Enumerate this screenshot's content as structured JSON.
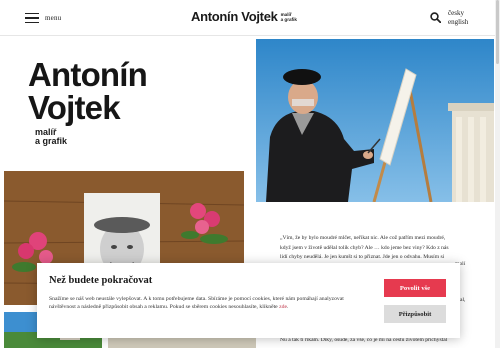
{
  "header": {
    "menu_label": "menu",
    "logo_name": "Antonín Vojtek",
    "logo_sub_1": "malíř",
    "logo_sub_2": "a grafik",
    "languages": [
      "česky",
      "english"
    ]
  },
  "hero": {
    "title_line1": "Antonín",
    "title_line2": "Vojtek",
    "sub_line1": "malíř",
    "sub_line2": "a grafik"
  },
  "article": {
    "lines": [
      "„Vím, že by bylo moudré mlčet, neříkat nic. Ale což patřím mezi moudré,",
      "když jsem v životě udělal tolik chyb? Ale … kdo jeme bez viny? Kdo z nás",
      "lidí chyby neudělá. Je jen kumšt si to přiznat. Jde jen o odvahu. Musím si"
    ],
    "clip_a": "molí",
    "clip_b": "al,",
    "tail": "Nu a tak ti říkám. Díky, osude, za vše, co je mi na cestu životem přichystal"
  },
  "cookie": {
    "title": "Než budete pokračovat",
    "text": "Snažíme se náš web neustále vylepšovat. A k tomu potřebujeme data. Sbíráme je pomocí cookies, které nám pomáhají analyzovat návštěvnost a následně přizpůsobit obsah a reklamu. Pokud se sběrem cookies nesouhlasíte, klikněte",
    "link": "zde",
    "period": ".",
    "allow_label": "Povolit vše",
    "custom_label": "Přizpůsobit"
  },
  "icons": {
    "menu": "hamburger-icon",
    "search": "search-icon"
  },
  "colors": {
    "accent": "#e63a4f",
    "secondary_button": "#dcdcdc",
    "text": "#1a1a1a"
  }
}
